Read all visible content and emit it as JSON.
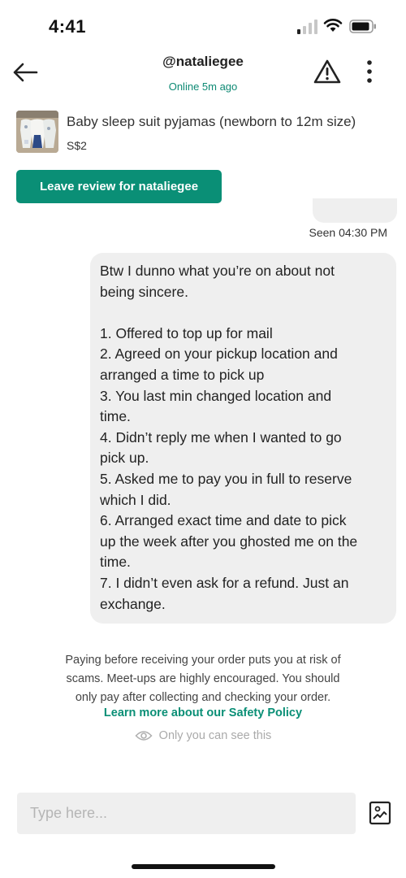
{
  "status_bar": {
    "time": "4:41"
  },
  "header": {
    "username": "@nataliegee",
    "online_status": "Online 5m ago"
  },
  "product": {
    "title": "Baby sleep suit pyjamas (newborn to 12m size)",
    "price": "S$2"
  },
  "review_button": {
    "label": "Leave review for nataliegee"
  },
  "chat": {
    "seen_label": "Seen 04:30 PM",
    "message_lines": [
      "Btw I dunno what you’re on about not",
      "being sincere.",
      "",
      "1. Offered to top up for mail",
      "2. Agreed on your pickup location and",
      "arranged a time to pick up",
      "3. You last min changed location and",
      "time.",
      "4. Didn’t reply me when I wanted to go",
      "pick up.",
      "5. Asked me to pay you in full to reserve",
      "which I did.",
      "6. Arranged exact time and date to pick",
      "up the week after you ghosted me on the",
      "time.",
      "7. I didn’t even ask for a refund. Just an",
      "exchange."
    ]
  },
  "safety_notice": {
    "lines": [
      "Paying before receiving your order puts you at risk of",
      "scams. Meet-ups are highly encouraged. You should",
      "only pay after collecting and checking your order."
    ],
    "link": "Learn more about our Safety Policy",
    "visibility": "Only you can see this"
  },
  "composer": {
    "placeholder": "Type here..."
  },
  "colors": {
    "accent": "#0a8f76",
    "bubble": "#efefef"
  },
  "icons": [
    "back-arrow-icon",
    "warning-triangle-icon",
    "more-vertical-icon",
    "eye-icon",
    "photo-checklist-icon",
    "signal-icon",
    "wifi-icon",
    "battery-icon"
  ]
}
